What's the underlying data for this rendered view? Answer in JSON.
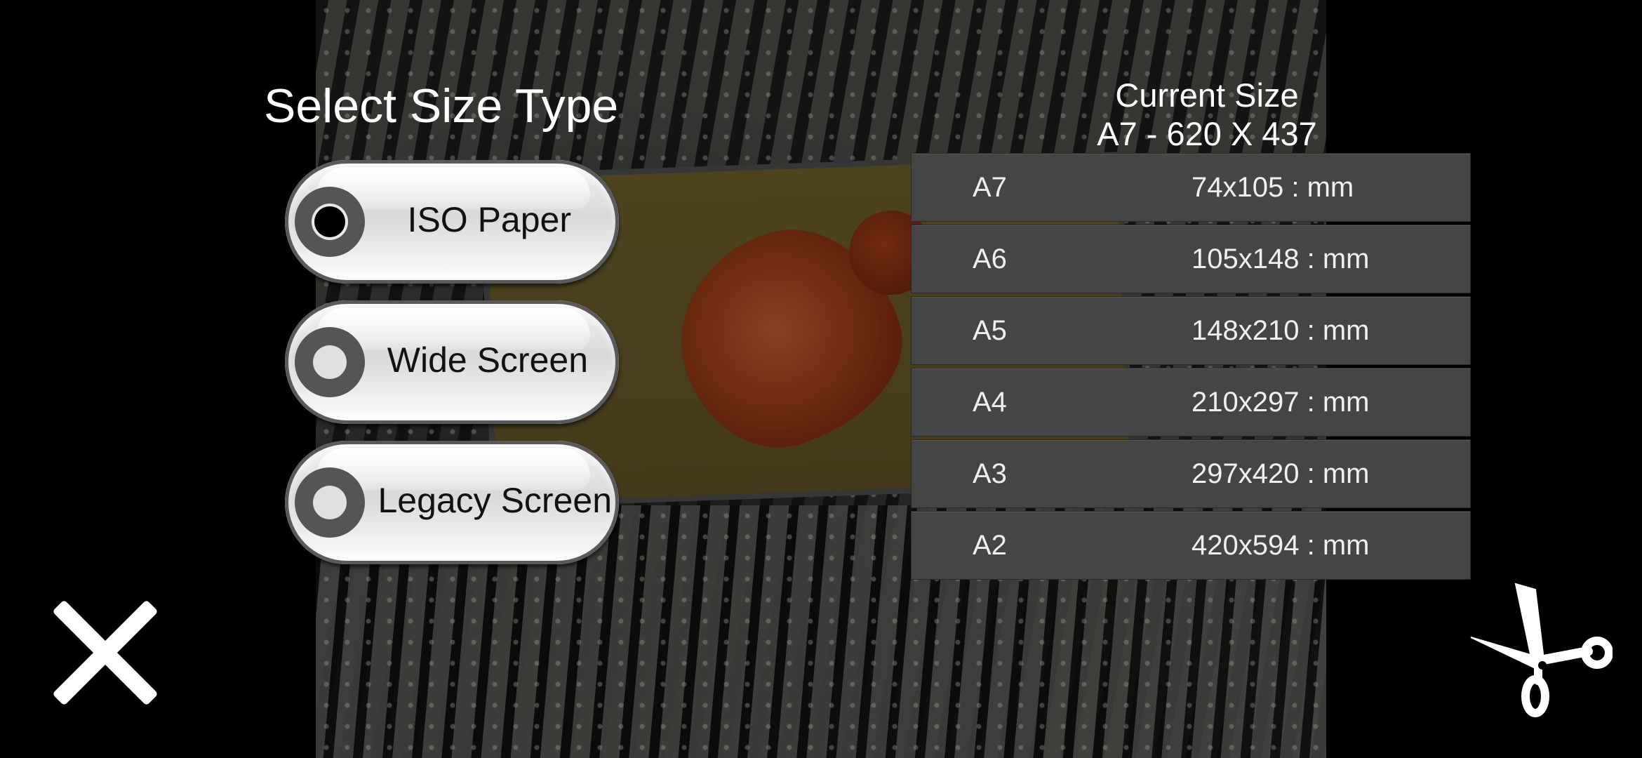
{
  "screen": {
    "title": "Select Size Type",
    "current_size": {
      "label": "Current Size",
      "value": "A7 - 620 X 437"
    }
  },
  "size_types": [
    {
      "label": "ISO Paper",
      "selected": true
    },
    {
      "label": "Wide Screen",
      "selected": false
    },
    {
      "label": "Legacy Screen",
      "selected": false
    }
  ],
  "sizes": [
    {
      "name": "A7",
      "dims": "74x105 : mm"
    },
    {
      "name": "A6",
      "dims": "105x148 : mm"
    },
    {
      "name": "A5",
      "dims": "148x210 : mm"
    },
    {
      "name": "A4",
      "dims": "210x297 : mm"
    },
    {
      "name": "A3",
      "dims": "297x420 : mm"
    },
    {
      "name": "A2",
      "dims": "420x594 : mm"
    }
  ],
  "actions": {
    "close_icon": "close-icon",
    "crop_icon": "scissors-icon"
  },
  "colors": {
    "background": "#000000",
    "row_background": "#454545",
    "text": "#ffffff",
    "radio_ring": "#555555"
  }
}
